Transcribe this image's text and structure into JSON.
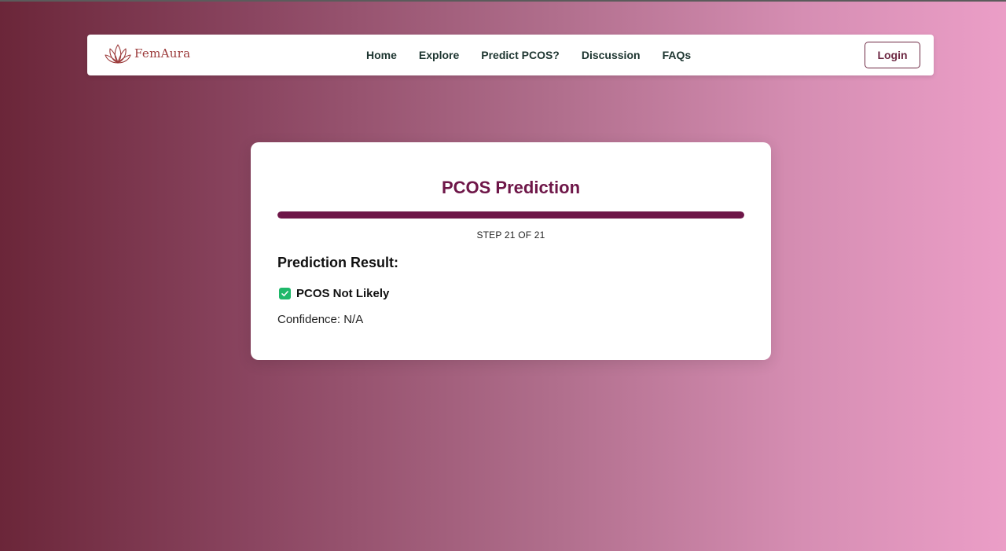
{
  "brand": {
    "name": "FemAura"
  },
  "nav": {
    "links": [
      "Home",
      "Explore",
      "Predict PCOS?",
      "Discussion",
      "FAQs"
    ],
    "login_label": "Login"
  },
  "card": {
    "title": "PCOS Prediction",
    "progress": {
      "current_step": 21,
      "total_steps": 21,
      "fraction": 1.0
    },
    "step_text": "STEP 21 OF 21",
    "result_heading": "Prediction Result:",
    "result_text": "PCOS Not Likely",
    "confidence_text": "Confidence: N/A"
  },
  "colors": {
    "accent": "#6e1648",
    "brand": "#9c3b3b",
    "success": "#1fb86a",
    "background_start": "#6b2639",
    "background_end": "#eb9ec7"
  },
  "icons": {
    "logo": "lotus-icon",
    "result": "check-icon"
  }
}
